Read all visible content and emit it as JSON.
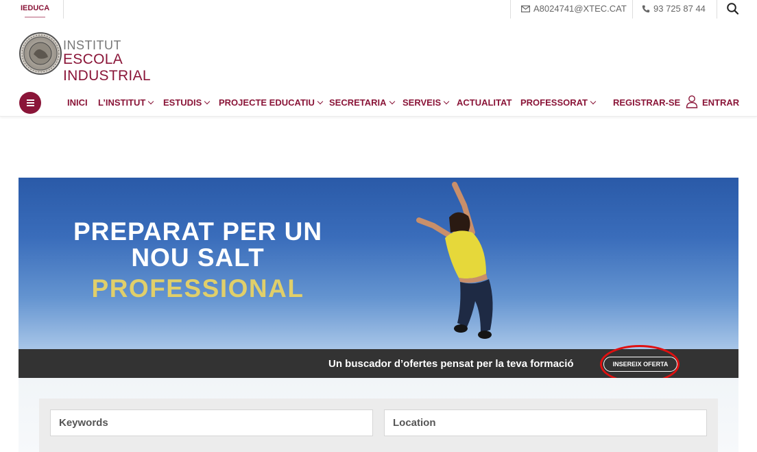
{
  "topbar": {
    "brand": "IEDUCA",
    "email": "A8024741@XTEC.CAT",
    "phone": "93 725 87 44"
  },
  "logo": {
    "line1": "INSTITUT",
    "line2": "ESCOLA INDUSTRIAL"
  },
  "nav": {
    "items": [
      {
        "label": "INICI"
      },
      {
        "label": "L’INSTITUT"
      },
      {
        "label": "ESTUDIS"
      },
      {
        "label": "PROJECTE EDUCATIU"
      },
      {
        "label": "SECRETARIA"
      },
      {
        "label": "SERVEIS"
      },
      {
        "label": "ACTUALITAT"
      },
      {
        "label": "PROFESSORAT"
      }
    ],
    "register": "REGISTRAR-SE",
    "login": "ENTRAR"
  },
  "hero": {
    "line1": "PREPARAT PER UN",
    "line2": "NOU SALT",
    "line3": "PROFESSIONAL"
  },
  "strip": {
    "text": "Un buscador d’ofertes pensat per la teva formació",
    "button": "INSEREIX OFERTA"
  },
  "search": {
    "keywords_placeholder": "Keywords",
    "location_placeholder": "Location"
  },
  "colors": {
    "brand": "#8a1538",
    "accent": "#e0cf6a",
    "strip": "#333333",
    "highlight": "#e01010"
  },
  "icons": {
    "email": "envelope-icon",
    "phone": "phone-icon",
    "search": "search-icon",
    "menu": "hamburger-icon",
    "user": "user-icon"
  }
}
